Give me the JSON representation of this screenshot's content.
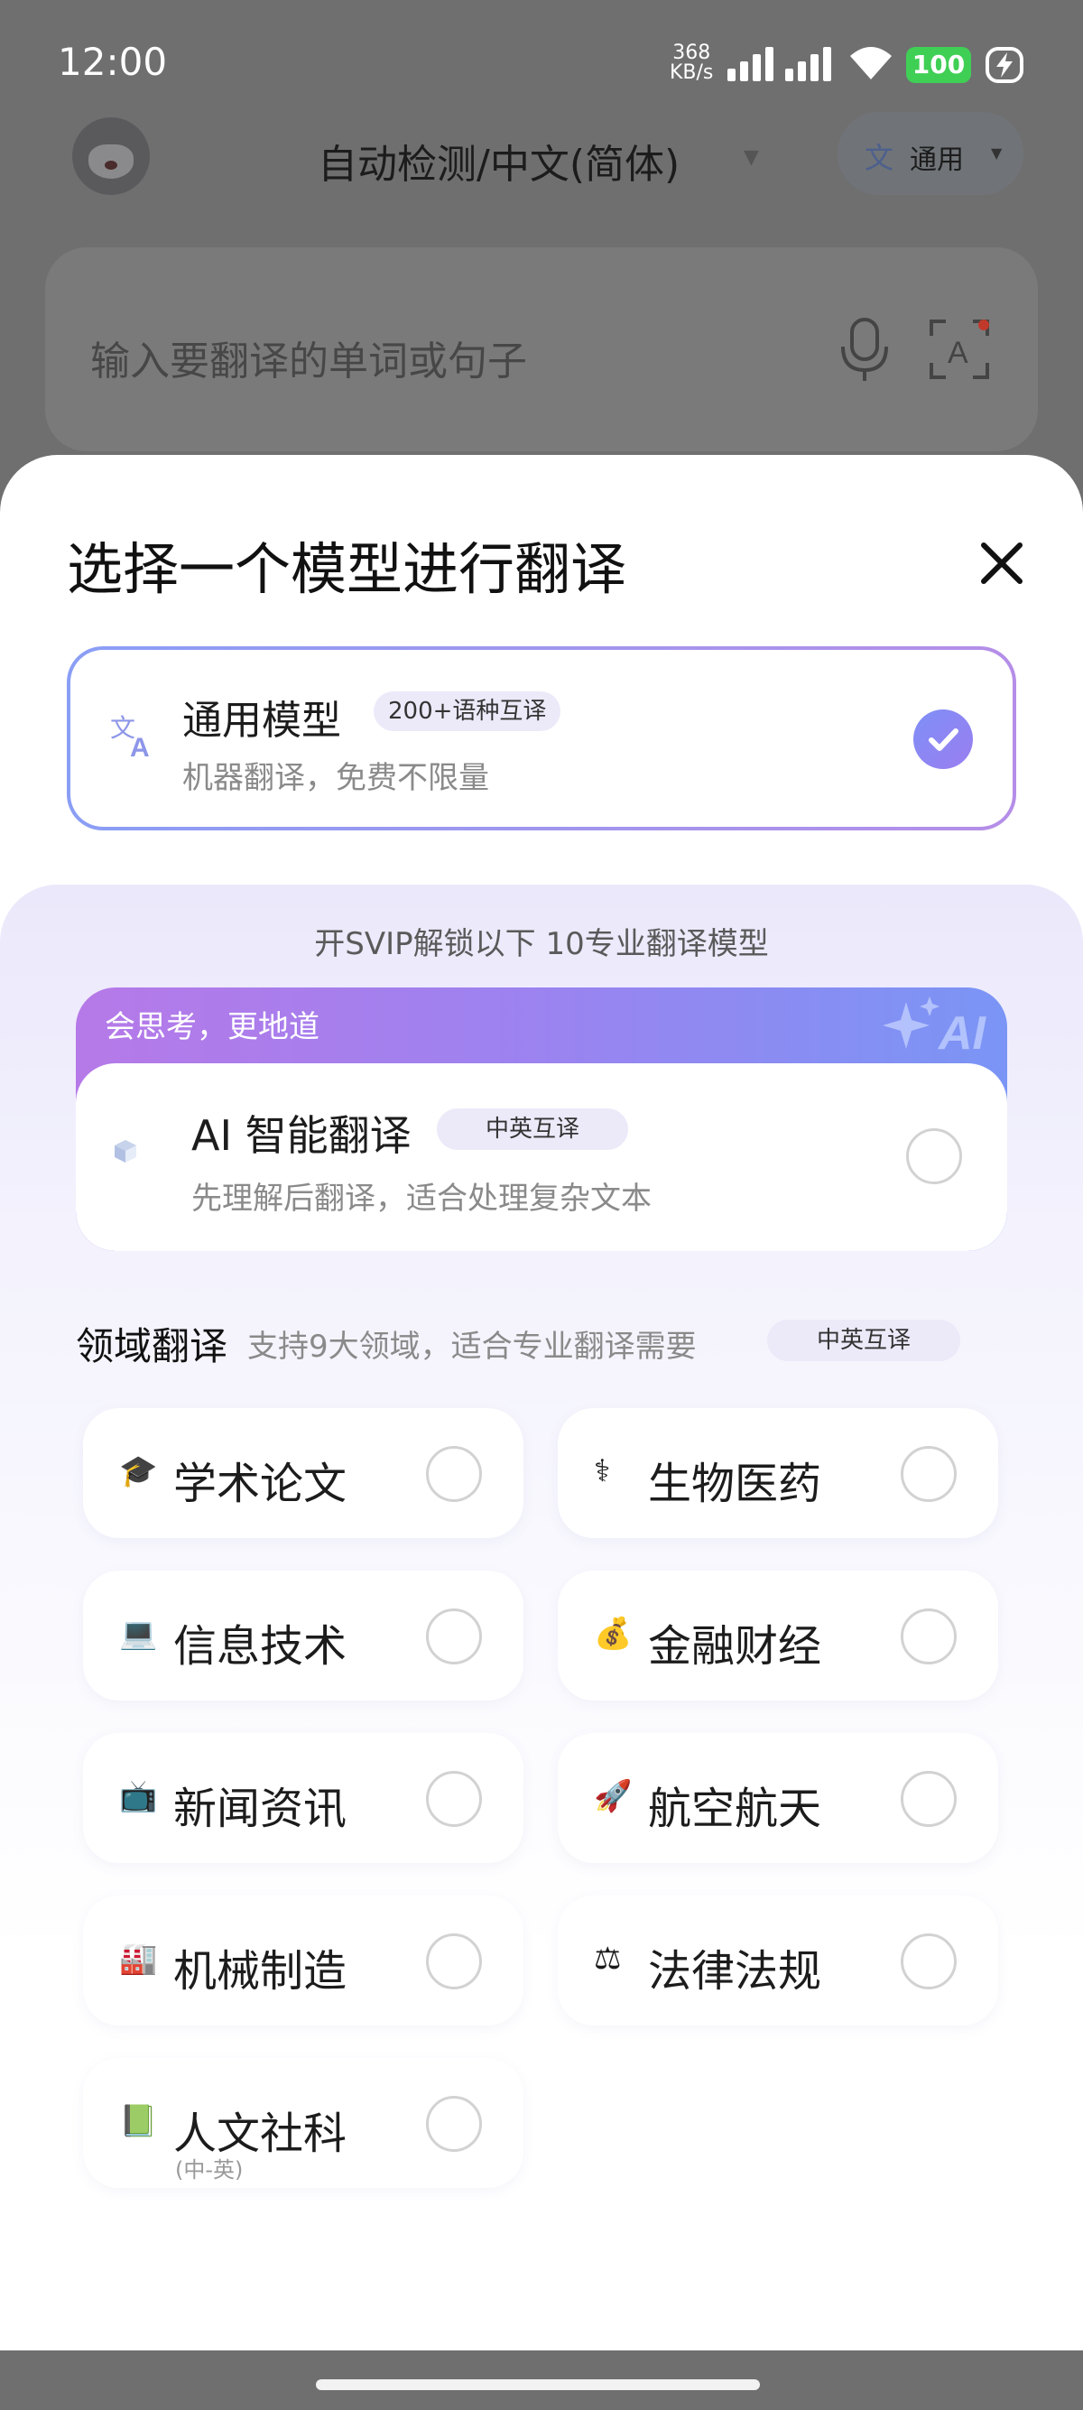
{
  "status_bar": {
    "time": "12:00",
    "net_speed": "368",
    "net_unit": "KB/s",
    "battery": "100",
    "battery_color": "#3fcf55"
  },
  "header": {
    "language_pair": "自动检测/中文(简体)",
    "model_chip_label": "通用"
  },
  "input": {
    "placeholder": "输入要翻译的单词或句子"
  },
  "sheet": {
    "title": "选择一个模型进行翻译",
    "general_model": {
      "name": "通用模型",
      "badge": "200+语种互译",
      "description": "机器翻译，免费不限量",
      "selected": true
    },
    "svip_text": "开SVIP解锁以下 10专业翻译模型",
    "ai_model": {
      "tag": "会思考，更地道",
      "name": "AI 智能翻译",
      "badge": "中英互译",
      "description": "先理解后翻译，适合处理复杂文本",
      "sparkle_text": "AI"
    },
    "domain": {
      "title": "领域翻译",
      "subtitle": "支持9大领域，适合专业翻译需要",
      "badge": "中英互译",
      "items": [
        {
          "label": "学术论文",
          "icon": "🎓",
          "icon_name": "graduation-cap-icon"
        },
        {
          "label": "生物医药",
          "icon": "⚕",
          "icon_name": "medical-icon"
        },
        {
          "label": "信息技术",
          "icon": "💻",
          "icon_name": "laptop-icon"
        },
        {
          "label": "金融财经",
          "icon": "💰",
          "icon_name": "money-bag-icon"
        },
        {
          "label": "新闻资讯",
          "icon": "📺",
          "icon_name": "television-icon"
        },
        {
          "label": "航空航天",
          "icon": "🚀",
          "icon_name": "rocket-icon"
        },
        {
          "label": "机械制造",
          "icon": "🏭",
          "icon_name": "factory-icon"
        },
        {
          "label": "法律法规",
          "icon": "⚖",
          "icon_name": "scales-icon"
        },
        {
          "label": "人文社科",
          "icon": "📗",
          "icon_name": "book-icon",
          "sublabel": "(中-英)"
        }
      ]
    }
  },
  "colors": {
    "accent_start": "#7f8ff6",
    "accent_end": "#b58ee8",
    "ai_gradient_start": "#b679e8",
    "ai_gradient_end": "#7a95f5"
  }
}
